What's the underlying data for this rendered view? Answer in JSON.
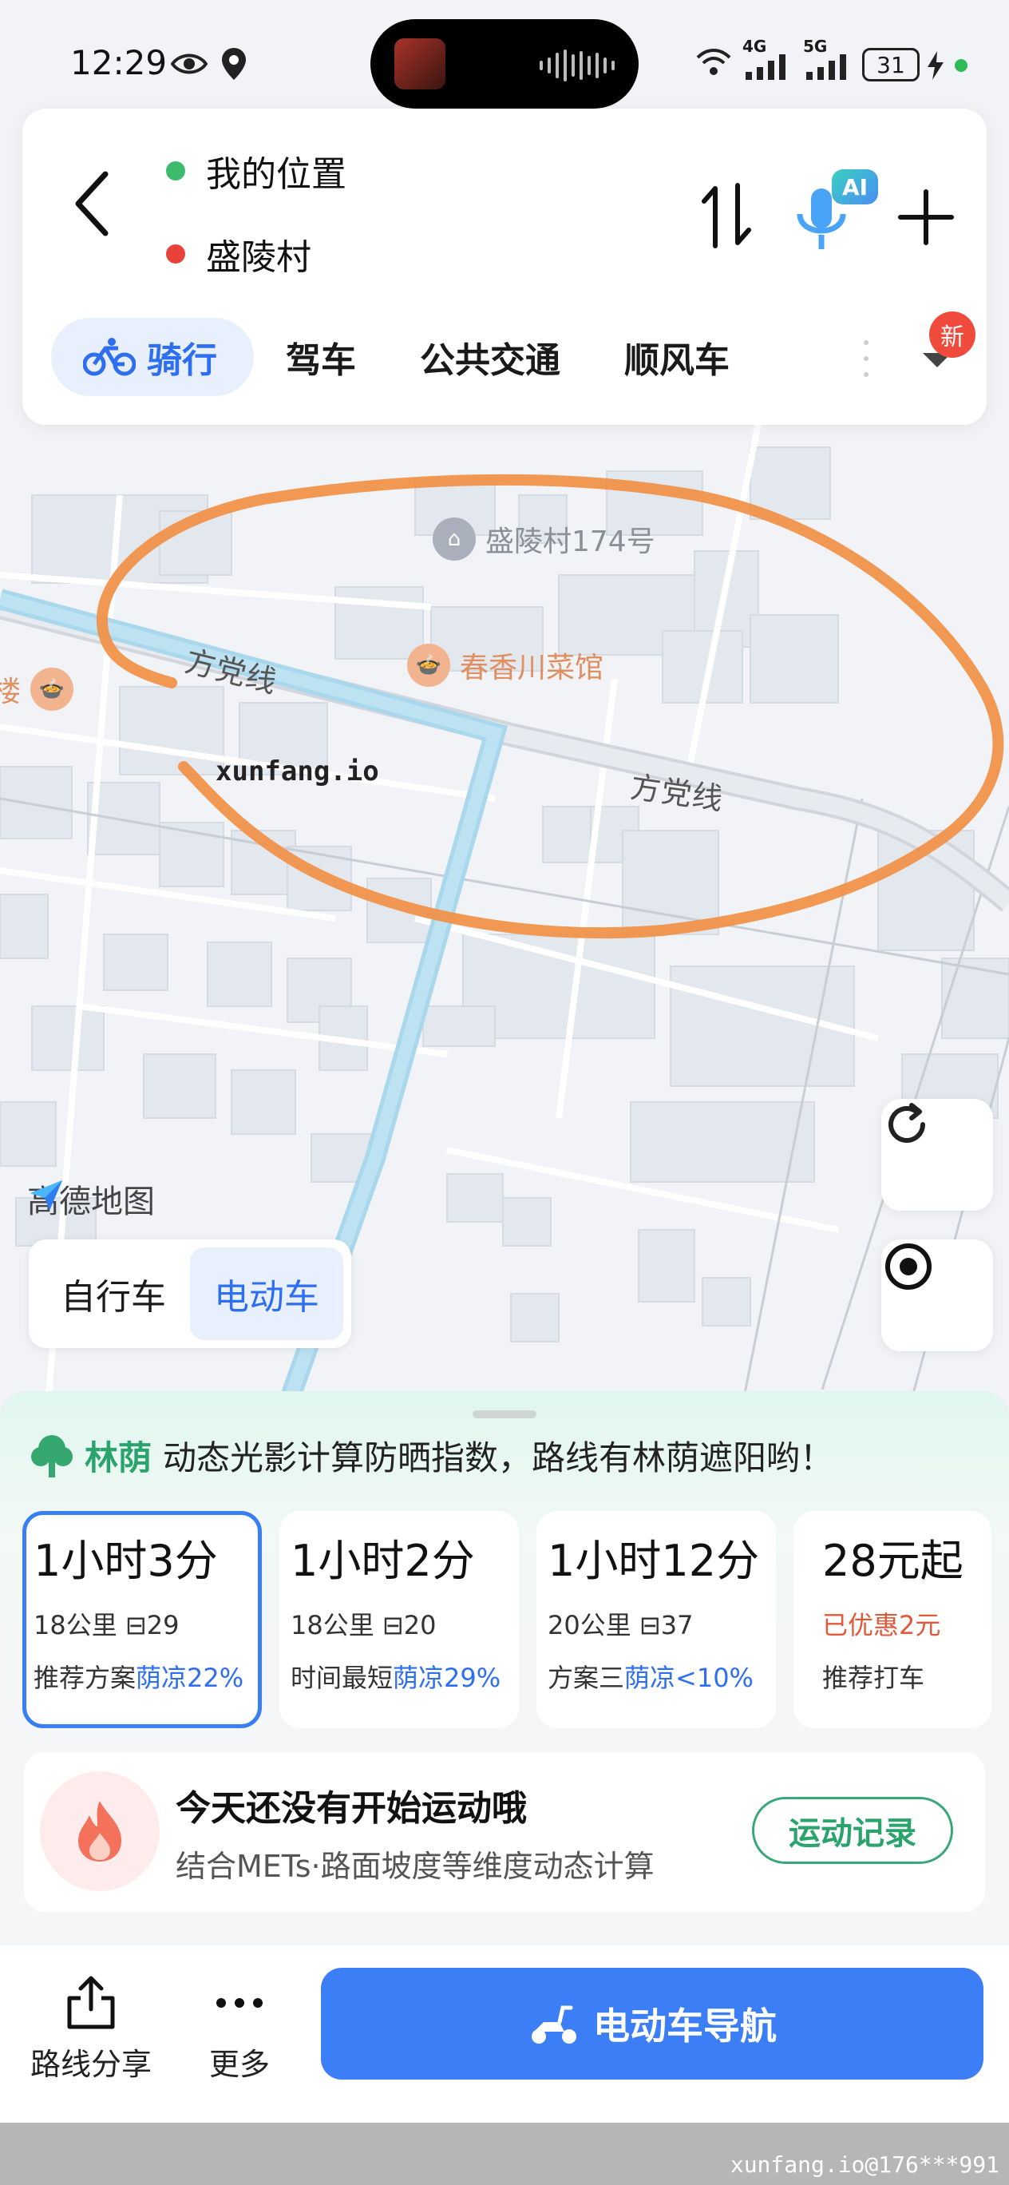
{
  "status_bar": {
    "time": "12:29",
    "network_4g": "4G",
    "network_5g": "5G",
    "battery": "31"
  },
  "route_input": {
    "origin": "我的位置",
    "destination": "盛陵村"
  },
  "ai_label": "AI",
  "mode_tabs": [
    "骑行",
    "驾车",
    "公共交通",
    "顺风车"
  ],
  "new_badge": "新",
  "map": {
    "poi_village": "盛陵村174号",
    "poi_restaurant": "春香川菜馆",
    "poi_building": "楼",
    "road_1": "方党线",
    "road_2": "方党线",
    "watermark": "xunfang.io",
    "logo": "高德地图"
  },
  "bike_switch": {
    "bicycle": "自行车",
    "ebike": "电动车"
  },
  "shade_tip": {
    "tag": "林荫",
    "text": "动态光影计算防晒指数，路线有林荫遮阳哟！"
  },
  "routes": [
    {
      "time": "1小时3分",
      "distance": "18公里",
      "lights": "29",
      "note": "推荐方案",
      "shade": "荫凉22%"
    },
    {
      "time": "1小时2分",
      "distance": "18公里",
      "lights": "20",
      "note": "时间最短",
      "shade": "荫凉29%"
    },
    {
      "time": "1小时12分",
      "distance": "20公里",
      "lights": "37",
      "note": "方案三",
      "shade": "荫凉<10%"
    },
    {
      "time": "28元起",
      "discount": "已优惠2元",
      "note": "推荐打车"
    }
  ],
  "sport": {
    "title": "今天还没有开始运动哦",
    "subtitle": "结合METs·路面坡度等维度动态计算",
    "button": "运动记录"
  },
  "bottom": {
    "share": "路线分享",
    "more": "更多",
    "navigate": "电动车导航"
  },
  "footer_watermark": "xunfang.io@176***991"
}
